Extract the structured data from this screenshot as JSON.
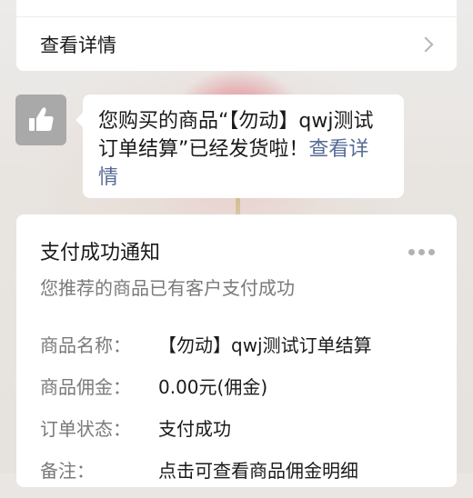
{
  "top_card": {
    "details_label": "查看详情"
  },
  "message": {
    "text": "您购买的商品“【勿动】qwj测试订单结算”已经发货啦！",
    "link": "查看详情"
  },
  "notice": {
    "title": "支付成功通知",
    "subtitle": "您推荐的商品已有客户支付成功",
    "fields": [
      {
        "key": "商品名称：",
        "value": "【勿动】qwj测试订单结算"
      },
      {
        "key": "商品佣金：",
        "value": "0.00元(佣金)"
      },
      {
        "key": "订单状态：",
        "value": "支付成功"
      },
      {
        "key": "备注：",
        "value": "点击可查看商品佣金明细"
      }
    ]
  },
  "icons": {
    "avatar": "thumbs-up-icon",
    "details": "chevron-right-icon",
    "menu": "more-dots-icon"
  }
}
